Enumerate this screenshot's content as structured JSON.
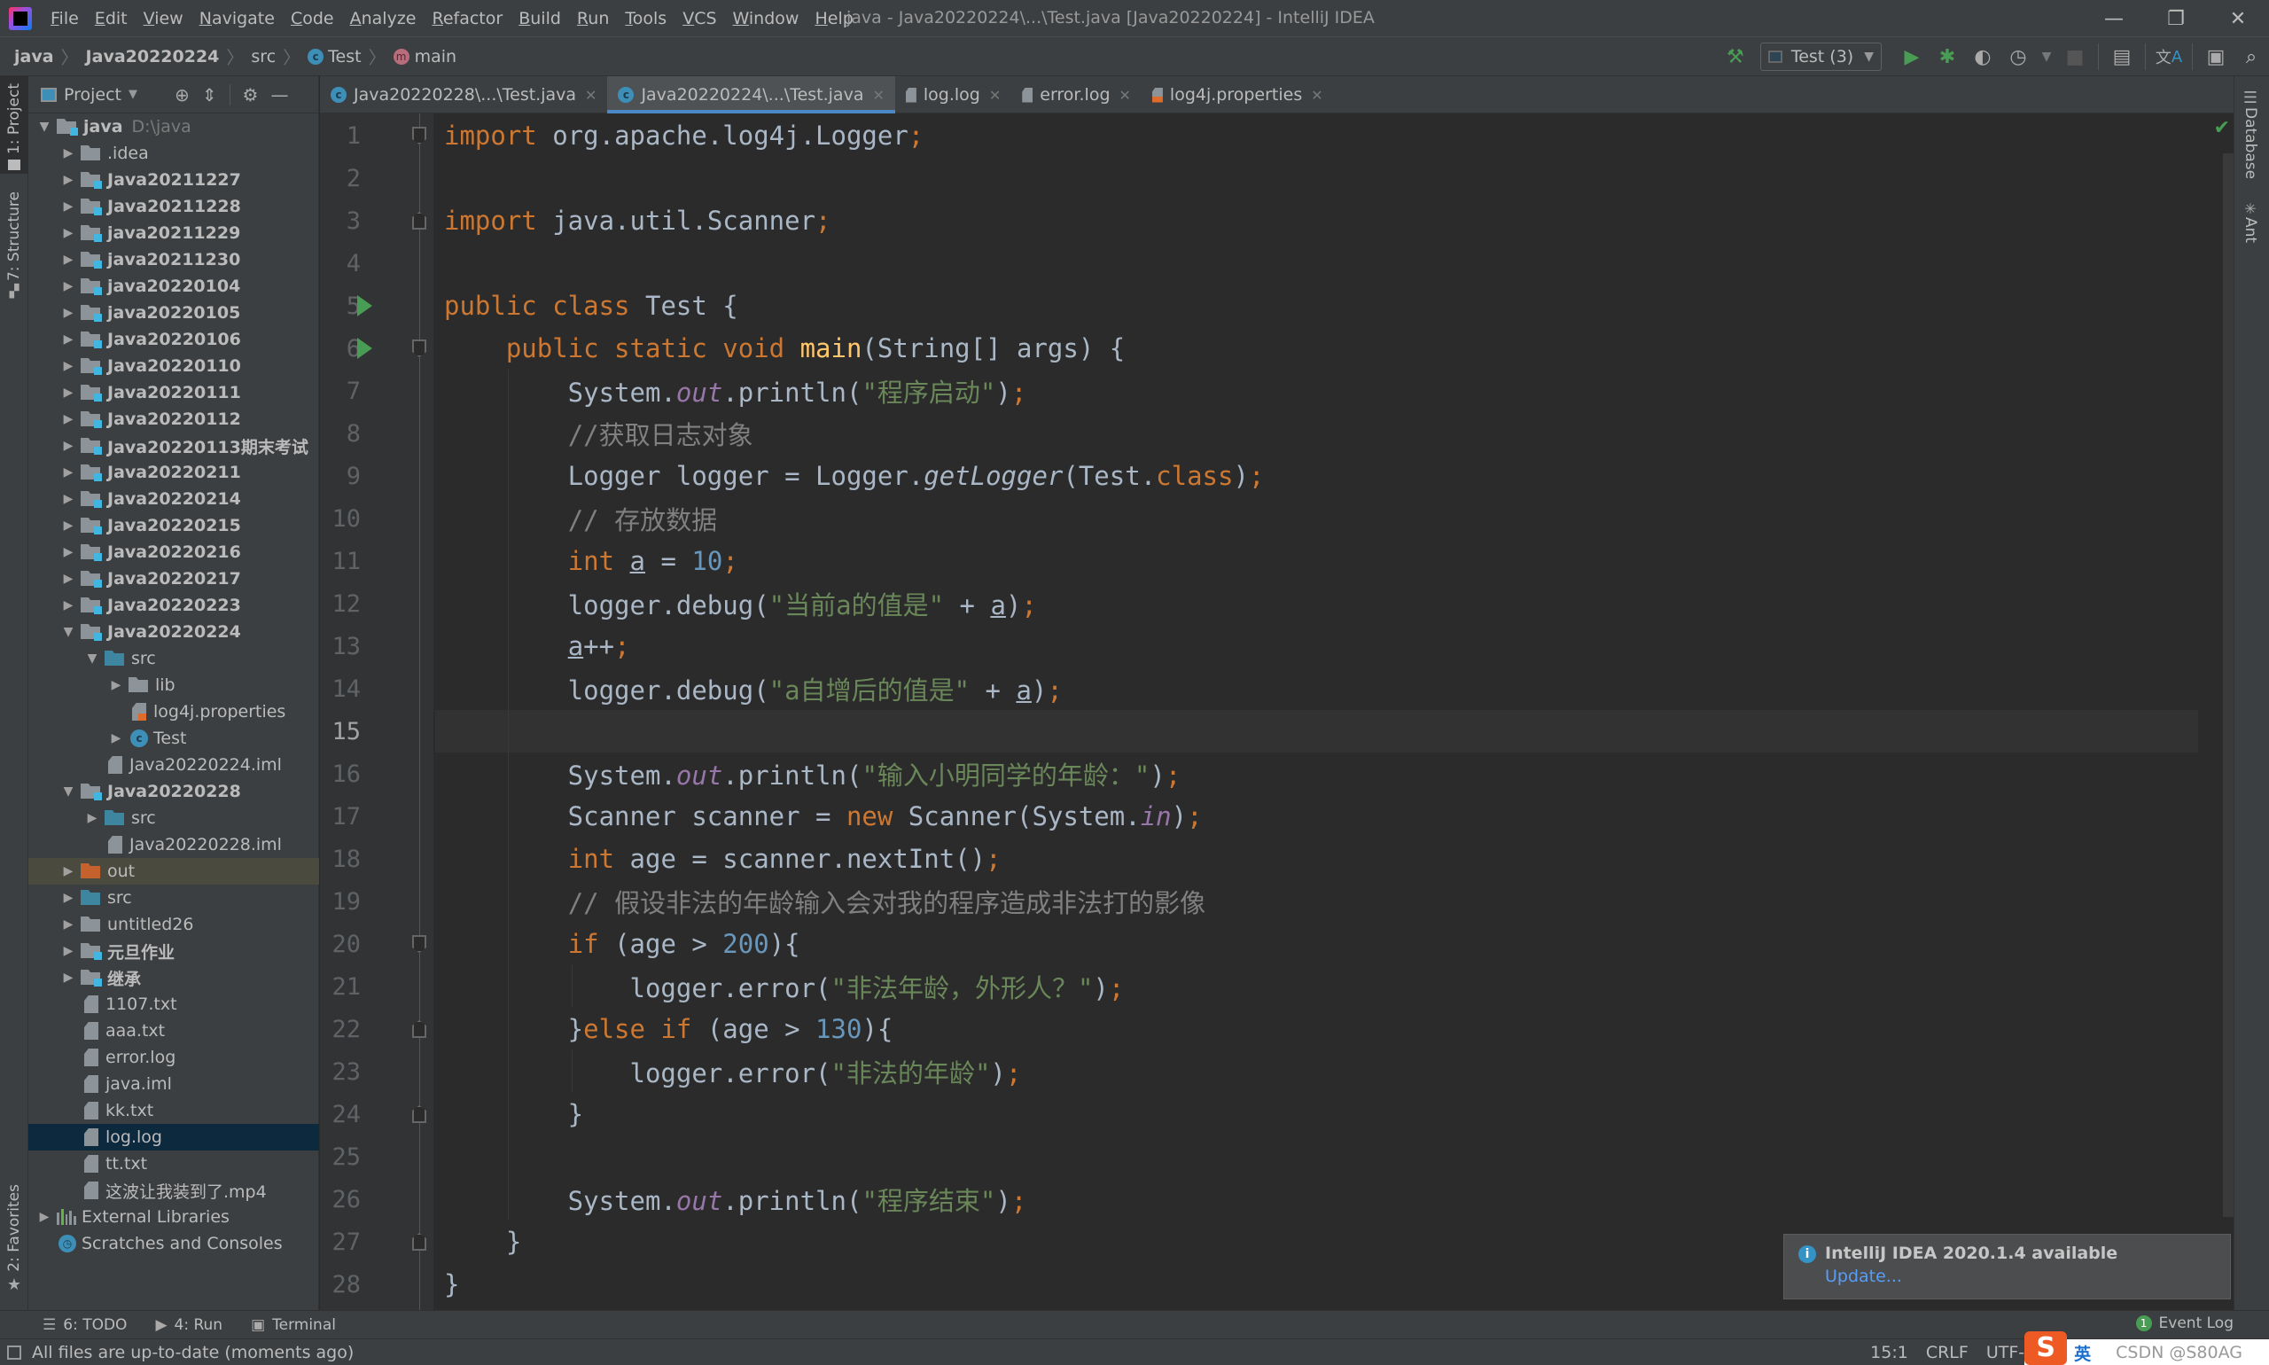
{
  "titlebar": {
    "menu": [
      "File",
      "Edit",
      "View",
      "Navigate",
      "Code",
      "Analyze",
      "Refactor",
      "Build",
      "Run",
      "Tools",
      "VCS",
      "Window",
      "Help"
    ],
    "window_title": "java - Java20220224\\...\\Test.java [Java20220224] - IntelliJ IDEA",
    "controls": {
      "minimize": "—",
      "restore": "❐",
      "close": "✕"
    }
  },
  "breadcrumb": {
    "items": [
      "java",
      "Java20220224",
      "src",
      "Test",
      "main"
    ],
    "separator": "〉"
  },
  "toolbar": {
    "run_config": "Test (3)",
    "icons": [
      "build-hammer-icon",
      "run-icon",
      "debug-icon",
      "coverage-icon",
      "profile-icon",
      "stop-icon",
      "project-structure-icon",
      "translate-icon",
      "terminal-icon",
      "search-icon"
    ]
  },
  "left_stripe": {
    "project": "1: Project",
    "structure": "7: Structure",
    "favorites": "2: Favorites"
  },
  "project_panel": {
    "title": "Project",
    "tree": [
      {
        "label": "java",
        "hint": "D:\\java",
        "depth": 0,
        "arrow": "down",
        "icon": "module",
        "bold": true
      },
      {
        "label": ".idea",
        "depth": 1,
        "arrow": "right",
        "icon": "folder"
      },
      {
        "label": "Java20211227",
        "depth": 1,
        "arrow": "right",
        "icon": "module",
        "bold": true
      },
      {
        "label": "Java20211228",
        "depth": 1,
        "arrow": "right",
        "icon": "module",
        "bold": true
      },
      {
        "label": "java20211229",
        "depth": 1,
        "arrow": "right",
        "icon": "module",
        "bold": true
      },
      {
        "label": "java20211230",
        "depth": 1,
        "arrow": "right",
        "icon": "module",
        "bold": true
      },
      {
        "label": "java20220104",
        "depth": 1,
        "arrow": "right",
        "icon": "module",
        "bold": true
      },
      {
        "label": "java20220105",
        "depth": 1,
        "arrow": "right",
        "icon": "module",
        "bold": true
      },
      {
        "label": "Java20220106",
        "depth": 1,
        "arrow": "right",
        "icon": "module",
        "bold": true
      },
      {
        "label": "Java20220110",
        "depth": 1,
        "arrow": "right",
        "icon": "module",
        "bold": true
      },
      {
        "label": "Java20220111",
        "depth": 1,
        "arrow": "right",
        "icon": "module",
        "bold": true
      },
      {
        "label": "Java20220112",
        "depth": 1,
        "arrow": "right",
        "icon": "module",
        "bold": true
      },
      {
        "label": "Java20220113期末考试",
        "depth": 1,
        "arrow": "right",
        "icon": "module",
        "bold": true
      },
      {
        "label": "Java20220211",
        "depth": 1,
        "arrow": "right",
        "icon": "module",
        "bold": true
      },
      {
        "label": "Java20220214",
        "depth": 1,
        "arrow": "right",
        "icon": "module",
        "bold": true
      },
      {
        "label": "Java20220215",
        "depth": 1,
        "arrow": "right",
        "icon": "module",
        "bold": true
      },
      {
        "label": "Java20220216",
        "depth": 1,
        "arrow": "right",
        "icon": "module",
        "bold": true
      },
      {
        "label": "Java20220217",
        "depth": 1,
        "arrow": "right",
        "icon": "module",
        "bold": true
      },
      {
        "label": "Java20220223",
        "depth": 1,
        "arrow": "right",
        "icon": "module",
        "bold": true
      },
      {
        "label": "Java20220224",
        "depth": 1,
        "arrow": "down",
        "icon": "module",
        "bold": true
      },
      {
        "label": "src",
        "depth": 2,
        "arrow": "down",
        "icon": "src"
      },
      {
        "label": "lib",
        "depth": 3,
        "arrow": "right",
        "icon": "folder"
      },
      {
        "label": "log4j.properties",
        "depth": 3,
        "arrow": "none",
        "icon": "properties"
      },
      {
        "label": "Test",
        "depth": 3,
        "arrow": "right",
        "icon": "class"
      },
      {
        "label": "Java20220224.iml",
        "depth": 2,
        "arrow": "none",
        "icon": "iml"
      },
      {
        "label": "Java20220228",
        "depth": 1,
        "arrow": "down",
        "icon": "module",
        "bold": true
      },
      {
        "label": "src",
        "depth": 2,
        "arrow": "right",
        "icon": "src"
      },
      {
        "label": "Java20220228.iml",
        "depth": 2,
        "arrow": "none",
        "icon": "iml"
      },
      {
        "label": "out",
        "depth": 1,
        "arrow": "right",
        "icon": "out",
        "highlight": true
      },
      {
        "label": "src",
        "depth": 1,
        "arrow": "right",
        "icon": "src"
      },
      {
        "label": "untitled26",
        "depth": 1,
        "arrow": "right",
        "icon": "folder"
      },
      {
        "label": "元旦作业",
        "depth": 1,
        "arrow": "right",
        "icon": "module",
        "bold": true
      },
      {
        "label": "继承",
        "depth": 1,
        "arrow": "right",
        "icon": "module",
        "bold": true
      },
      {
        "label": "1107.txt",
        "depth": 1,
        "arrow": "none",
        "icon": "file"
      },
      {
        "label": "aaa.txt",
        "depth": 1,
        "arrow": "none",
        "icon": "file"
      },
      {
        "label": "error.log",
        "depth": 1,
        "arrow": "none",
        "icon": "file"
      },
      {
        "label": "java.iml",
        "depth": 1,
        "arrow": "none",
        "icon": "iml"
      },
      {
        "label": "kk.txt",
        "depth": 1,
        "arrow": "none",
        "icon": "file"
      },
      {
        "label": "log.log",
        "depth": 1,
        "arrow": "none",
        "icon": "file",
        "selected": true
      },
      {
        "label": "tt.txt",
        "depth": 1,
        "arrow": "none",
        "icon": "file"
      },
      {
        "label": "这波让我装到了.mp4",
        "depth": 1,
        "arrow": "none",
        "icon": "unknown"
      },
      {
        "label": "External Libraries",
        "depth": 0,
        "arrow": "right",
        "icon": "library"
      },
      {
        "label": "Scratches and Consoles",
        "depth": 0,
        "arrow": "none",
        "icon": "scratch"
      }
    ]
  },
  "editor_tabs": [
    {
      "label": "Java20220228\\...\\Test.java",
      "icon": "class",
      "active": false
    },
    {
      "label": "Java20220224\\...\\Test.java",
      "icon": "class",
      "active": true
    },
    {
      "label": "log.log",
      "icon": "file",
      "active": false
    },
    {
      "label": "error.log",
      "icon": "file",
      "active": false
    },
    {
      "label": "log4j.properties",
      "icon": "properties",
      "active": false
    }
  ],
  "editor": {
    "current_line": 15,
    "lines": [
      {
        "n": "1",
        "fold": "start",
        "tokens": [
          [
            "k",
            "import"
          ],
          [
            "p",
            " org.apache.log4j.Logger"
          ],
          [
            "k",
            ";"
          ]
        ]
      },
      {
        "n": "2",
        "tokens": []
      },
      {
        "n": "3",
        "fold": "end",
        "tokens": [
          [
            "k",
            "import"
          ],
          [
            "p",
            " java.util.Scanner"
          ],
          [
            "k",
            ";"
          ]
        ]
      },
      {
        "n": "4",
        "tokens": []
      },
      {
        "n": "5",
        "run": true,
        "tokens": [
          [
            "k",
            "public class "
          ],
          [
            "p",
            "Test {"
          ]
        ]
      },
      {
        "n": "6",
        "run": true,
        "fold": "start",
        "tokens": [
          [
            "p",
            "    "
          ],
          [
            "k",
            "public static void "
          ],
          [
            "fn",
            "main"
          ],
          [
            "p",
            "(String[] args) {"
          ]
        ]
      },
      {
        "n": "7",
        "tokens": [
          [
            "p",
            "        System."
          ],
          [
            "f",
            "out"
          ],
          [
            "p",
            ".println("
          ],
          [
            "s",
            "\"程序启动\""
          ],
          [
            "p",
            ")"
          ],
          [
            "k",
            ";"
          ]
        ]
      },
      {
        "n": "8",
        "tokens": [
          [
            "p",
            "        "
          ],
          [
            "c",
            "//获取日志对象"
          ]
        ]
      },
      {
        "n": "9",
        "tokens": [
          [
            "p",
            "        Logger logger = Logger."
          ],
          [
            "it",
            "getLogger"
          ],
          [
            "p",
            "(Test."
          ],
          [
            "k",
            "class"
          ],
          [
            "p",
            ")"
          ],
          [
            "k",
            ";"
          ]
        ]
      },
      {
        "n": "10",
        "tokens": [
          [
            "p",
            "        "
          ],
          [
            "c",
            "// 存放数据"
          ]
        ]
      },
      {
        "n": "11",
        "tokens": [
          [
            "p",
            "        "
          ],
          [
            "k",
            "int "
          ],
          [
            "u",
            "a"
          ],
          [
            "p",
            " = "
          ],
          [
            "n",
            "10"
          ],
          [
            "k",
            ";"
          ]
        ]
      },
      {
        "n": "12",
        "tokens": [
          [
            "p",
            "        logger.debug("
          ],
          [
            "s",
            "\"当前a的值是\""
          ],
          [
            "p",
            " + "
          ],
          [
            "u",
            "a"
          ],
          [
            "p",
            ")"
          ],
          [
            "k",
            ";"
          ]
        ]
      },
      {
        "n": "13",
        "tokens": [
          [
            "p",
            "        "
          ],
          [
            "u",
            "a"
          ],
          [
            "p",
            "++"
          ],
          [
            "k",
            ";"
          ]
        ]
      },
      {
        "n": "14",
        "tokens": [
          [
            "p",
            "        logger.debug("
          ],
          [
            "s",
            "\"a自增后的值是\""
          ],
          [
            "p",
            " + "
          ],
          [
            "u",
            "a"
          ],
          [
            "p",
            ")"
          ],
          [
            "k",
            ";"
          ]
        ]
      },
      {
        "n": "15",
        "tokens": []
      },
      {
        "n": "16",
        "tokens": [
          [
            "p",
            "        System."
          ],
          [
            "f",
            "out"
          ],
          [
            "p",
            ".println("
          ],
          [
            "s",
            "\"输入小明同学的年龄：\""
          ],
          [
            "p",
            ")"
          ],
          [
            "k",
            ";"
          ]
        ]
      },
      {
        "n": "17",
        "tokens": [
          [
            "p",
            "        Scanner scanner = "
          ],
          [
            "k",
            "new "
          ],
          [
            "p",
            "Scanner(System."
          ],
          [
            "f",
            "in"
          ],
          [
            "p",
            ")"
          ],
          [
            "k",
            ";"
          ]
        ]
      },
      {
        "n": "18",
        "tokens": [
          [
            "p",
            "        "
          ],
          [
            "k",
            "int "
          ],
          [
            "p",
            "age = scanner.nextInt()"
          ],
          [
            "k",
            ";"
          ]
        ]
      },
      {
        "n": "19",
        "tokens": [
          [
            "p",
            "        "
          ],
          [
            "c",
            "// 假设非法的年龄输入会对我的程序造成非法打的影像"
          ]
        ]
      },
      {
        "n": "20",
        "fold": "start",
        "tokens": [
          [
            "p",
            "        "
          ],
          [
            "k",
            "if "
          ],
          [
            "p",
            "(age > "
          ],
          [
            "n",
            "200"
          ],
          [
            "p",
            "){"
          ]
        ]
      },
      {
        "n": "21",
        "tokens": [
          [
            "p",
            "            logger.error("
          ],
          [
            "s",
            "\"非法年龄，外形人？\""
          ],
          [
            "p",
            ")"
          ],
          [
            "k",
            ";"
          ]
        ]
      },
      {
        "n": "22",
        "fold": "end",
        "tokens": [
          [
            "p",
            "        }"
          ],
          [
            "k",
            "else if "
          ],
          [
            "p",
            "(age > "
          ],
          [
            "n",
            "130"
          ],
          [
            "p",
            "){"
          ]
        ]
      },
      {
        "n": "23",
        "tokens": [
          [
            "p",
            "            logger.error("
          ],
          [
            "s",
            "\"非法的年龄\""
          ],
          [
            "p",
            ")"
          ],
          [
            "k",
            ";"
          ]
        ]
      },
      {
        "n": "24",
        "fold": "end",
        "tokens": [
          [
            "p",
            "        }"
          ]
        ]
      },
      {
        "n": "25",
        "tokens": []
      },
      {
        "n": "26",
        "tokens": [
          [
            "p",
            "        System."
          ],
          [
            "f",
            "out"
          ],
          [
            "p",
            ".println("
          ],
          [
            "s",
            "\"程序结束\""
          ],
          [
            "p",
            ")"
          ],
          [
            "k",
            ";"
          ]
        ]
      },
      {
        "n": "27",
        "fold": "end",
        "tokens": [
          [
            "p",
            "    }"
          ]
        ]
      },
      {
        "n": "28",
        "tokens": [
          [
            "p",
            "}"
          ]
        ]
      }
    ]
  },
  "right_stripe": {
    "database": "Database",
    "ant": "Ant"
  },
  "notification": {
    "title": "IntelliJ IDEA 2020.1.4 available",
    "link": "Update..."
  },
  "bottom_tools": {
    "todo": "6: TODO",
    "run": "4: Run",
    "terminal": "Terminal",
    "event_log": "Event Log",
    "event_count": "1"
  },
  "statusbar": {
    "message": "All files are up-to-date (moments ago)",
    "position": "15:1",
    "line_sep": "CRLF",
    "encoding": "UTF-",
    "ime_lang": "英",
    "watermark": "CSDN @S80AG"
  },
  "colors": {
    "keyword": "#cc7832",
    "string": "#6a8759",
    "number": "#6897bb",
    "comment": "#808080",
    "field": "#9876aa",
    "method": "#ffc66d",
    "accent": "#4a88c7",
    "run_green": "#499c54"
  }
}
